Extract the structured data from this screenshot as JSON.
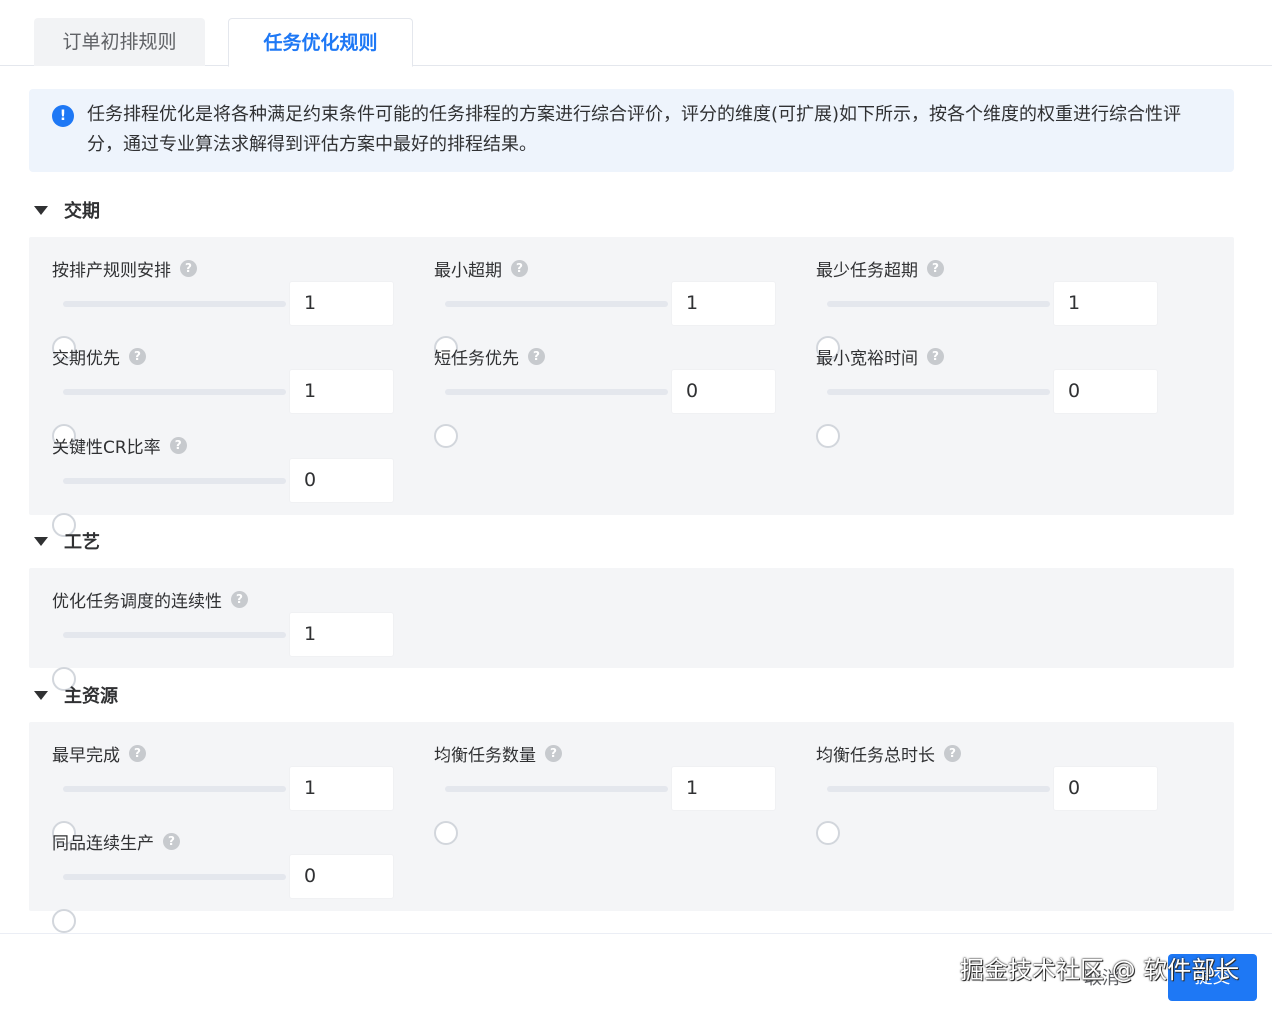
{
  "tabs": [
    {
      "label": "订单初排规则",
      "active": false
    },
    {
      "label": "任务优化规则",
      "active": true
    }
  ],
  "alert": {
    "icon": "exclamation-icon",
    "text": "任务排程优化是将各种满足约束条件可能的任务排程的方案进行综合评价，评分的维度(可扩展)如下所示，按各个维度的权重进行综合性评分，通过专业算法求解得到评估方案中最好的排程结果。"
  },
  "sections": {
    "delivery": {
      "title": "交期",
      "items": [
        {
          "label": "按排产规则安排",
          "value": "1"
        },
        {
          "label": "最小超期",
          "value": "1"
        },
        {
          "label": "最少任务超期",
          "value": "1"
        },
        {
          "label": "交期优先",
          "value": "1"
        },
        {
          "label": "短任务优先",
          "value": "0"
        },
        {
          "label": "最小宽裕时间",
          "value": "0"
        },
        {
          "label": "关键性CR比率",
          "value": "0"
        }
      ]
    },
    "process": {
      "title": "工艺",
      "items": [
        {
          "label": "优化任务调度的连续性",
          "value": "1"
        }
      ]
    },
    "resource": {
      "title": "主资源",
      "items": [
        {
          "label": "最早完成",
          "value": "1"
        },
        {
          "label": "均衡任务数量",
          "value": "1"
        },
        {
          "label": "均衡任务总时长",
          "value": "0"
        },
        {
          "label": "同品连续生产",
          "value": "0"
        }
      ]
    }
  },
  "help_glyph": "?",
  "footer": {
    "cancel_label": "取消",
    "submit_label": "提交",
    "watermark": "掘金技术社区 @ 软件部长"
  },
  "colors": {
    "accent": "#1e78f5",
    "panel_bg": "#f4f5f7",
    "alert_bg": "#eef4fc"
  }
}
